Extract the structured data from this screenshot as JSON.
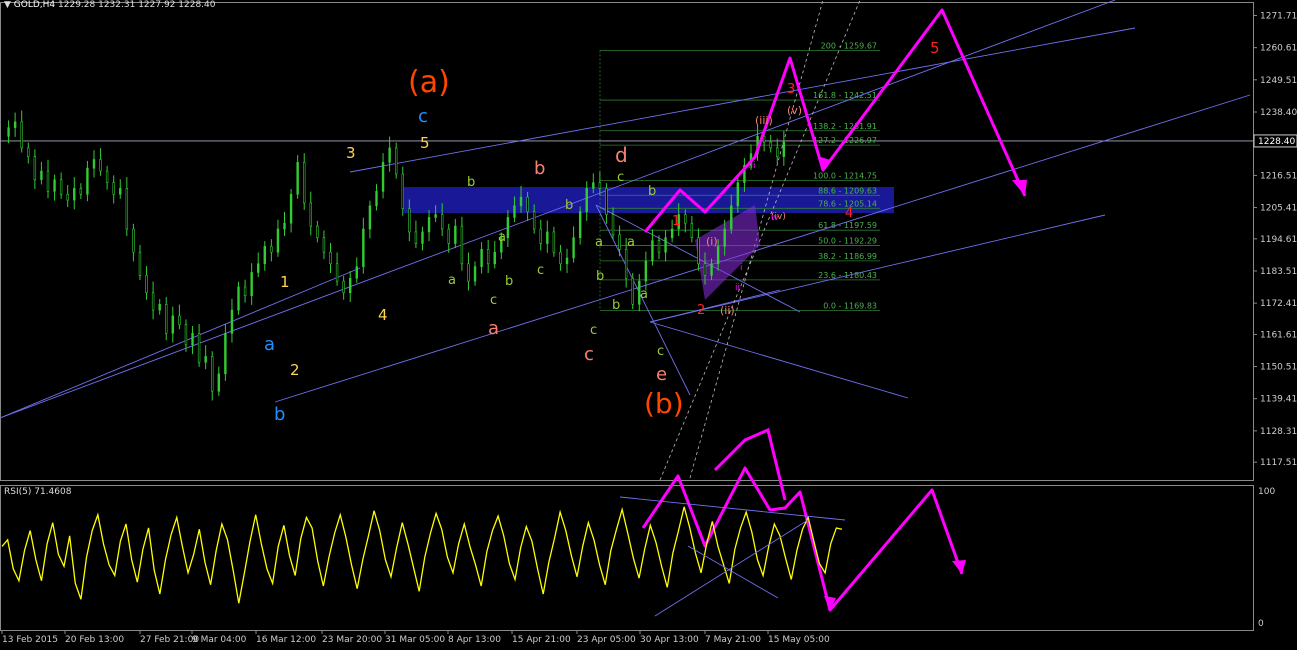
{
  "header": {
    "symbol": "GOLD,H4",
    "ohlc": "1229.28 1232.31 1227.92 1228.40",
    "current_price": "1228.40"
  },
  "rsi_header": "RSI(5) 71.4608",
  "colors": {
    "background": "#000000",
    "grid": "#8a8a8a",
    "candle": "#32cd32",
    "channel": "#7070f0",
    "zone": "#1c1ca8",
    "fib": "#2e7d32",
    "fib_text": "#4caf50",
    "projection": "#ff00ff",
    "rsi": "#ffff00",
    "wave_label_big": "#ff4500",
    "wave_label_blue": "#1e90ff",
    "wave_label_yellow": "#ffd54f",
    "wave_label_green": "#9acd32",
    "wave_label_salmon": "#fa8072",
    "wave_label_red": "#ff2020"
  },
  "chart_data": [
    {
      "type": "candlestick",
      "title": "GOLD,H4",
      "xlabel": "",
      "ylabel": "",
      "ylim": [
        1115.0,
        1276.0
      ],
      "grid": false,
      "y_ticks": [
        "1271.71",
        "1260.61",
        "1249.51",
        "1238.40",
        "1227.30",
        "1216.51",
        "1205.41",
        "1194.61",
        "1183.51",
        "1172.41",
        "1161.61",
        "1150.51",
        "1139.41",
        "1128.31",
        "1117.51"
      ],
      "x_ticks": [
        "13 Feb 2015",
        "20 Feb 13:00",
        "27 Feb 21:00",
        "9 Mar 04:00",
        "16 Mar 12:00",
        "23 Mar 20:00",
        "31 Mar 05:00",
        "8 Apr 13:00",
        "15 Apr 21:00",
        "23 Apr 05:00",
        "30 Apr 13:00",
        "7 May 21:00",
        "15 May 05:00"
      ],
      "close_path": [
        [
          0,
          1230
        ],
        [
          3,
          1233
        ],
        [
          6,
          1235
        ],
        [
          9,
          1226
        ],
        [
          12,
          1223
        ],
        [
          15,
          1215
        ],
        [
          18,
          1218
        ],
        [
          21,
          1211
        ],
        [
          24,
          1215
        ],
        [
          27,
          1210
        ],
        [
          30,
          1208
        ],
        [
          33,
          1212
        ],
        [
          36,
          1210
        ],
        [
          39,
          1219
        ],
        [
          42,
          1222
        ],
        [
          45,
          1218
        ],
        [
          48,
          1214
        ],
        [
          51,
          1210
        ],
        [
          54,
          1212
        ],
        [
          57,
          1198
        ],
        [
          60,
          1190
        ],
        [
          63,
          1182
        ],
        [
          66,
          1176
        ],
        [
          69,
          1170
        ],
        [
          72,
          1172
        ],
        [
          75,
          1162
        ],
        [
          78,
          1168
        ],
        [
          81,
          1165
        ],
        [
          84,
          1158
        ],
        [
          87,
          1162
        ],
        [
          90,
          1152
        ],
        [
          93,
          1154
        ],
        [
          96,
          1142
        ],
        [
          99,
          1148
        ],
        [
          102,
          1162
        ],
        [
          105,
          1170
        ],
        [
          108,
          1178
        ],
        [
          111,
          1175
        ],
        [
          114,
          1183
        ],
        [
          117,
          1186
        ],
        [
          120,
          1192
        ],
        [
          123,
          1190
        ],
        [
          126,
          1198
        ],
        [
          129,
          1200
        ],
        [
          132,
          1210
        ],
        [
          135,
          1221
        ],
        [
          138,
          1207
        ],
        [
          141,
          1199
        ],
        [
          144,
          1195
        ],
        [
          147,
          1190
        ],
        [
          150,
          1186
        ],
        [
          153,
          1180
        ],
        [
          156,
          1176
        ],
        [
          159,
          1181
        ],
        [
          162,
          1185
        ],
        [
          165,
          1198
        ],
        [
          168,
          1206
        ],
        [
          171,
          1211
        ],
        [
          174,
          1221
        ],
        [
          177,
          1226
        ],
        [
          180,
          1217
        ],
        [
          183,
          1205
        ],
        [
          186,
          1197
        ],
        [
          189,
          1193
        ],
        [
          192,
          1197
        ],
        [
          195,
          1202
        ],
        [
          198,
          1203
        ],
        [
          201,
          1198
        ],
        [
          204,
          1193
        ],
        [
          207,
          1199
        ],
        [
          210,
          1186
        ],
        [
          213,
          1180
        ],
        [
          216,
          1185
        ],
        [
          219,
          1191
        ],
        [
          222,
          1186
        ],
        [
          225,
          1190
        ],
        [
          228,
          1195
        ],
        [
          231,
          1202
        ],
        [
          234,
          1206
        ],
        [
          237,
          1209
        ],
        [
          240,
          1204
        ],
        [
          243,
          1198
        ],
        [
          246,
          1193
        ],
        [
          249,
          1197
        ],
        [
          252,
          1190
        ],
        [
          255,
          1186
        ],
        [
          258,
          1188
        ],
        [
          261,
          1195
        ],
        [
          264,
          1204
        ],
        [
          267,
          1212
        ],
        [
          270,
          1214
        ],
        [
          273,
          1212
        ],
        [
          276,
          1203
        ],
        [
          279,
          1196
        ],
        [
          282,
          1191
        ],
        [
          285,
          1181
        ],
        [
          288,
          1172
        ],
        [
          291,
          1180
        ],
        [
          294,
          1187
        ],
        [
          297,
          1194
        ],
        [
          300,
          1190
        ],
        [
          303,
          1195
        ],
        [
          306,
          1198
        ],
        [
          309,
          1203
        ],
        [
          312,
          1200
        ],
        [
          315,
          1195
        ],
        [
          318,
          1186
        ],
        [
          321,
          1182
        ],
        [
          324,
          1186
        ],
        [
          327,
          1192
        ],
        [
          330,
          1198
        ],
        [
          333,
          1206
        ],
        [
          336,
          1214
        ],
        [
          339,
          1220
        ],
        [
          342,
          1224
        ],
        [
          345,
          1230
        ],
        [
          348,
          1228
        ],
        [
          351,
          1226
        ],
        [
          354,
          1223
        ],
        [
          357,
          1228
        ]
      ],
      "fib_levels": [
        {
          "ratio": "200",
          "value": "1259.67"
        },
        {
          "ratio": "161.8",
          "value": "1242.51"
        },
        {
          "ratio": "138.2",
          "value": "1231.91"
        },
        {
          "ratio": "127.2",
          "value": "1226.97"
        },
        {
          "ratio": "100.0",
          "value": "1214.75"
        },
        {
          "ratio": "88.6",
          "value": "1209.63"
        },
        {
          "ratio": "78.6",
          "value": "1205.14"
        },
        {
          "ratio": "61.8",
          "value": "1197.59"
        },
        {
          "ratio": "50.0",
          "value": "1192.29"
        },
        {
          "ratio": "38.2",
          "value": "1186.99"
        },
        {
          "ratio": "23.6",
          "value": "1180.43"
        },
        {
          "ratio": "0.0",
          "value": "1169.83"
        }
      ],
      "wave_labels": [
        {
          "text": "(a)",
          "color": "wave_label_big"
        },
        {
          "text": "c",
          "color": "wave_label_blue"
        },
        {
          "text": "5",
          "color": "wave_label_yellow"
        },
        {
          "text": "3",
          "color": "wave_label_yellow"
        },
        {
          "text": "1",
          "color": "wave_label_yellow"
        },
        {
          "text": "2",
          "color": "wave_label_yellow"
        },
        {
          "text": "4",
          "color": "wave_label_yellow"
        },
        {
          "text": "a",
          "color": "wave_label_blue"
        },
        {
          "text": "b",
          "color": "wave_label_blue"
        },
        {
          "text": "b",
          "color": "wave_label_green"
        },
        {
          "text": "a",
          "color": "wave_label_green"
        },
        {
          "text": "a",
          "color": "wave_label_green"
        },
        {
          "text": "b",
          "color": "wave_label_green"
        },
        {
          "text": "c",
          "color": "wave_label_green"
        },
        {
          "text": "b",
          "color": "wave_label_green"
        },
        {
          "text": "a",
          "color": "wave_label_green"
        },
        {
          "text": "c",
          "color": "wave_label_green"
        },
        {
          "text": "b",
          "color": "wave_label_green"
        },
        {
          "text": "b",
          "color": "wave_label_green"
        },
        {
          "text": "a",
          "color": "wave_label_green"
        },
        {
          "text": "c",
          "color": "wave_label_green"
        },
        {
          "text": "b",
          "color": "wave_label_green"
        },
        {
          "text": "a",
          "color": "wave_label_green"
        },
        {
          "text": "c",
          "color": "wave_label_green"
        },
        {
          "text": "c",
          "color": "wave_label_green"
        },
        {
          "text": "b",
          "color": "wave_label_salmon"
        },
        {
          "text": "a",
          "color": "wave_label_salmon"
        },
        {
          "text": "c",
          "color": "wave_label_salmon"
        },
        {
          "text": "d",
          "color": "wave_label_salmon"
        },
        {
          "text": "e",
          "color": "wave_label_salmon"
        },
        {
          "text": "(b)",
          "color": "wave_label_big"
        },
        {
          "text": "1",
          "color": "wave_label_red"
        },
        {
          "text": "2",
          "color": "wave_label_red"
        },
        {
          "text": "3",
          "color": "wave_label_red"
        },
        {
          "text": "4",
          "color": "wave_label_red"
        },
        {
          "text": "5",
          "color": "wave_label_red"
        },
        {
          "text": "(i)",
          "color": "wave_label_salmon"
        },
        {
          "text": "(ii)",
          "color": "wave_label_salmon"
        },
        {
          "text": "(iii)",
          "color": "wave_label_salmon"
        },
        {
          "text": "(iv)",
          "color": "wave_label_salmon"
        },
        {
          "text": "(v)",
          "color": "wave_label_salmon"
        },
        {
          "text": "i",
          "color": "projection"
        },
        {
          "text": "ii",
          "color": "projection"
        },
        {
          "text": "iii",
          "color": "projection"
        },
        {
          "text": "iv",
          "color": "projection"
        }
      ]
    },
    {
      "type": "line",
      "title": "RSI(5) 71.4608",
      "xlabel": "",
      "ylabel": "",
      "ylim": [
        0,
        100
      ],
      "y_ticks": [
        "100",
        "0"
      ],
      "series": [
        {
          "name": "RSI(5)",
          "values": [
            58,
            63,
            41,
            32,
            55,
            70,
            48,
            32,
            60,
            76,
            52,
            43,
            66,
            30,
            18,
            50,
            70,
            82,
            60,
            44,
            36,
            62,
            75,
            48,
            31,
            56,
            72,
            40,
            22,
            48,
            67,
            80,
            58,
            38,
            52,
            71,
            46,
            29,
            55,
            75,
            63,
            40,
            15,
            38,
            62,
            82,
            60,
            41,
            30,
            58,
            74,
            51,
            36,
            64,
            80,
            72,
            47,
            28,
            50,
            68,
            82,
            65,
            44,
            26,
            48,
            66,
            85,
            70,
            48,
            35,
            57,
            76,
            60,
            42,
            24,
            50,
            68,
            83,
            71,
            50,
            38,
            60,
            75,
            58,
            44,
            28,
            54,
            70,
            81,
            66,
            45,
            33,
            57,
            73,
            62,
            41,
            22,
            46,
            64,
            84,
            70,
            51,
            35,
            58,
            76,
            63,
            44,
            29,
            55,
            71,
            86,
            68,
            49,
            34,
            56,
            74,
            61,
            43,
            27,
            53,
            70,
            88,
            72,
            53,
            38,
            60,
            77,
            58,
            44,
            30,
            56,
            72,
            84,
            69,
            48,
            36,
            58,
            75,
            66,
            49,
            33,
            55,
            71,
            80,
            62,
            45,
            38,
            60,
            72,
            71
          ]
        }
      ]
    }
  ]
}
